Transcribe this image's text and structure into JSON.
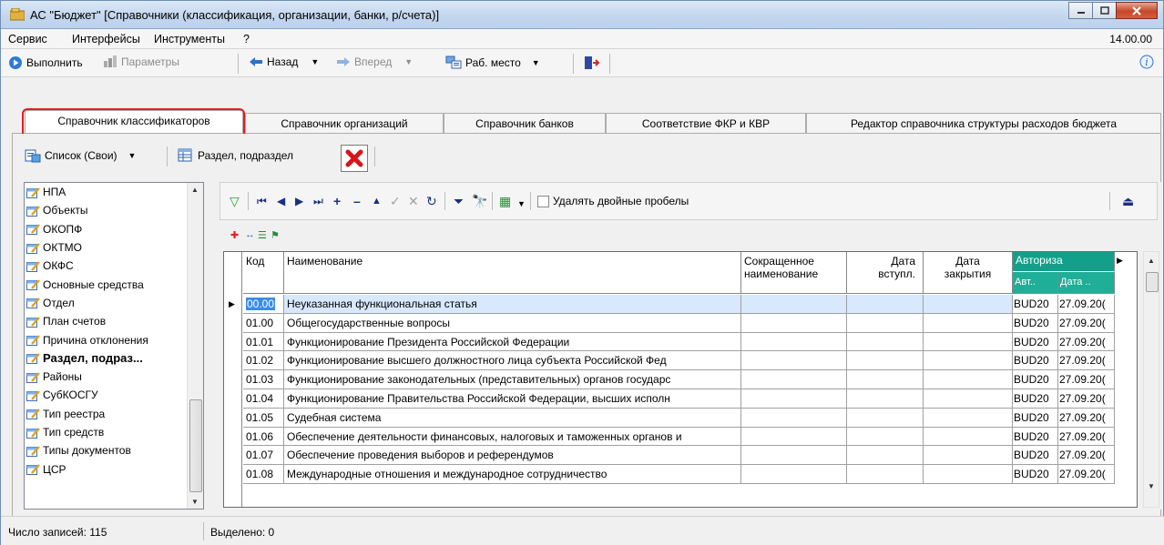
{
  "window": {
    "title": "АС \"Бюджет\" [Справочники (классификация, организации, банки, р/счета)]",
    "version": "14.00.00"
  },
  "menu": {
    "items": [
      "Сервис",
      "Интерфейсы",
      "Инструменты",
      "?"
    ]
  },
  "toolbar": {
    "execute": "Выполнить",
    "params": "Параметры",
    "back": "Назад",
    "forward": "Вперед",
    "workplace": "Раб. место"
  },
  "tabs": [
    {
      "label": "Справочник классификаторов",
      "active": true
    },
    {
      "label": "Справочник организаций",
      "active": false
    },
    {
      "label": "Справочник банков",
      "active": false
    },
    {
      "label": "Соответствие ФКР и КВР",
      "active": false
    },
    {
      "label": "Редактор справочника структуры расходов бюджета",
      "active": false
    }
  ],
  "subtoolbar": {
    "list": "Список (Свои)",
    "section": "Раздел, подраздел"
  },
  "left_list": {
    "items": [
      {
        "label": "НПА"
      },
      {
        "label": "Объекты"
      },
      {
        "label": "ОКОПФ"
      },
      {
        "label": "ОКТМО"
      },
      {
        "label": "ОКФС"
      },
      {
        "label": "Основные средства"
      },
      {
        "label": "Отдел"
      },
      {
        "label": "План счетов"
      },
      {
        "label": "Причина отклонения"
      },
      {
        "label": "Раздел, подраз...",
        "selected": true
      },
      {
        "label": "Районы"
      },
      {
        "label": "СубКОСГУ"
      },
      {
        "label": "Тип реестра"
      },
      {
        "label": "Тип средств"
      },
      {
        "label": "Типы документов"
      },
      {
        "label": "ЦСР"
      }
    ]
  },
  "grid_toolbar": {
    "remove_double_spaces": "Удалять двойные пробелы"
  },
  "grid": {
    "headers": {
      "code": "Код",
      "name": "Наименование",
      "short_name_1": "Сокращенное",
      "short_name_2": "наименование",
      "date_in_1": "Дата",
      "date_in_2": "вступл.",
      "date_close_1": "Дата",
      "date_close_2": "закрытия",
      "auth": "Авториза",
      "auth_author": "Авт..",
      "auth_date": "Дата .."
    },
    "rows": [
      {
        "code": "00.00",
        "name": "Неуказанная функциональная статья",
        "author": "BUD20",
        "date": "27.09.20("
      },
      {
        "code": "01.00",
        "name": "Общегосударственные вопросы",
        "author": "BUD20",
        "date": "27.09.20("
      },
      {
        "code": "01.01",
        "name": "Функционирование Президента Российской Федерации",
        "author": "BUD20",
        "date": "27.09.20("
      },
      {
        "code": "01.02",
        "name": "Функционирование высшего должностного лица субъекта Российской Фед",
        "author": "BUD20",
        "date": "27.09.20("
      },
      {
        "code": "01.03",
        "name": "Функционирование законодательных (представительных) органов государс",
        "author": "BUD20",
        "date": "27.09.20("
      },
      {
        "code": "01.04",
        "name": "Функционирование Правительства Российской Федерации, высших исполн",
        "author": "BUD20",
        "date": "27.09.20("
      },
      {
        "code": "01.05",
        "name": "Судебная система",
        "author": "BUD20",
        "date": "27.09.20("
      },
      {
        "code": "01.06",
        "name": "Обеспечение деятельности финансовых, налоговых и таможенных органов и",
        "author": "BUD20",
        "date": "27.09.20("
      },
      {
        "code": "01.07",
        "name": "Обеспечение проведения выборов и референдумов",
        "author": "BUD20",
        "date": "27.09.20("
      },
      {
        "code": "01.08",
        "name": "Международные отношения и международное сотрудничество",
        "author": "BUD20",
        "date": "27.09.20("
      }
    ]
  },
  "status": {
    "records": "Число записей: 115",
    "selected": "Выделено: 0"
  }
}
